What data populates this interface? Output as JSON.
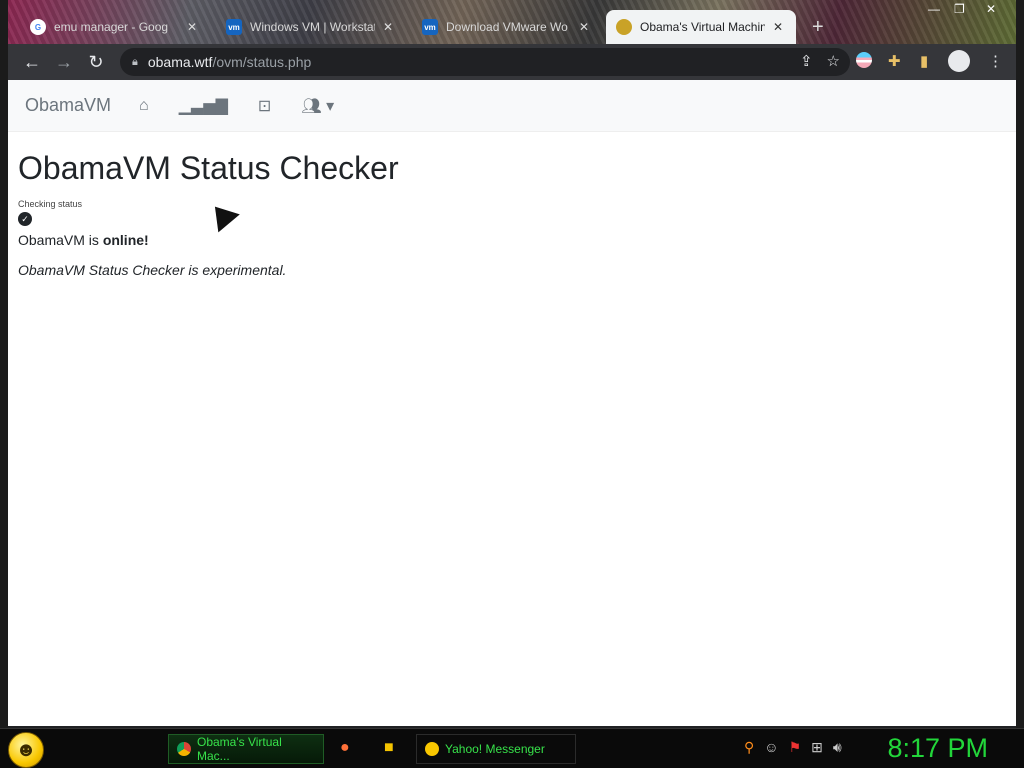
{
  "browser": {
    "tabs": [
      {
        "title": "emu manager - Goog",
        "favicon": "google-icon",
        "active": false
      },
      {
        "title": "Windows VM | Workstat",
        "favicon": "vmware-icon",
        "active": false
      },
      {
        "title": "Download VMware Wo",
        "favicon": "vmware-icon",
        "active": false
      },
      {
        "title": "Obama's Virtual Machine",
        "favicon": "obamavm-icon",
        "active": true
      }
    ],
    "url_host": "obama.wtf",
    "url_path": "/ovm/status.php"
  },
  "page": {
    "brand": "ObamaVM",
    "nav_icons": [
      "home-icon",
      "signal-icon",
      "robot-icon",
      "users-dropdown-icon"
    ],
    "title": "ObamaVM Status Checker",
    "checking_label": "Checking status",
    "status_prefix": "ObamaVM is ",
    "status_value": "online!",
    "note": "ObamaVM Status Checker is experimental."
  },
  "taskbar": {
    "tasks": [
      {
        "label": "Obama's Virtual Mac...",
        "icon": "chrome-icon",
        "active": true
      },
      {
        "label": "Yahoo! Messenger",
        "icon": "yahoo-messenger-icon",
        "active": false
      }
    ],
    "clock": "8:17 PM"
  }
}
